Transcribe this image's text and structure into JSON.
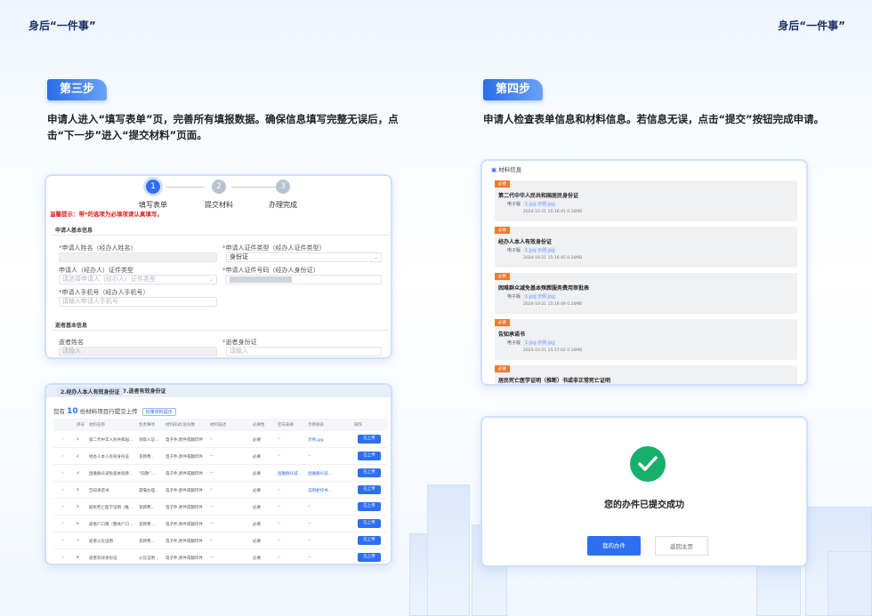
{
  "header": {
    "left_title": "身后“一件事”",
    "right_title": "身后“一件事”"
  },
  "step3": {
    "badge": "第三步",
    "desc_line1": "申请人进入“填写表单”页，完善所有填报数据。确保信息填写完整无误后，点",
    "desc_line2": "击“下一步”进入“提交材料”页面。"
  },
  "step4": {
    "badge": "第四步",
    "desc": "申请人检查表单信息和材料信息。若信息无误，点击“提交”按钮完成申请。"
  },
  "form_panel": {
    "steps": [
      {
        "num": "1",
        "label": "填写表单"
      },
      {
        "num": "2",
        "label": "提交材料"
      },
      {
        "num": "3",
        "label": "办理完成"
      }
    ],
    "warning": "温馨提示：带*的选项为必填项请认真填写。",
    "section1": "申请人基本信息",
    "f_name_label": "申请人姓名（经办人姓名）",
    "f_idtype_label": "申请人证件类型（经办人证件类型）",
    "f_idtype_value": "身份证",
    "f_idtype2_label": "申请人（经办人）证件类型",
    "f_idtype2_placeholder": "请选择申请人（经办人）证件类型",
    "f_idno_label": "申请人证件号码（经办人身份证）",
    "f_phone_label": "申请人手机号（经办人手机号）",
    "f_phone_placeholder": "请输入申请人手机号",
    "section2": "逝者基本信息",
    "f_dname_label": "逝者姓名",
    "f_dname_placeholder": "请输入",
    "f_did_label": "逝者身份证",
    "f_did_placeholder": "请输入",
    "required_mark": "*"
  },
  "table_panel": {
    "tab1": "2.经办人本人有效身份证",
    "tab2": "7.逝者有效身份证",
    "count_prefix": "您有",
    "count": "10",
    "count_suffix": "份材料项目行提交上传",
    "count_btn": "批量材料提示",
    "headers": [
      "序号",
      "材料名称",
      "负责事项",
      "材料形式/总份数",
      "材料描述",
      "必要性",
      "空白表格",
      "示例样表",
      "操作"
    ],
    "rows": [
      {
        "no": "1",
        "name": "第二代中华人民共和国…",
        "item": "领取人证…",
        "form": "电子件,原件或翻印件",
        "desc": "--",
        "need": "必要",
        "blank": "--",
        "sample": "示例.jpg",
        "op": "已上传"
      },
      {
        "no": "2",
        "name": "经办人本人有效身份证",
        "item": "丧葬费…",
        "form": "电子件,原件或翻印件",
        "desc": "--",
        "need": "必要",
        "blank": "--",
        "sample": "--",
        "op": "已上传"
      },
      {
        "no": "3",
        "name": "困难群众减免基本殡葬…",
        "item": "“四救”…",
        "form": "电子件,原件或翻印件",
        "desc": "--",
        "need": "必要",
        "blank": "困难群众减…",
        "sample": "困难群众减…",
        "op": "已上传"
      },
      {
        "no": "4",
        "name": "告知承诺书",
        "item": "遗嘱办理…",
        "form": "电子件,原件或翻印件",
        "desc": "--",
        "need": "必要",
        "blank": "--",
        "sample": "证明委托书…",
        "op": "已上传"
      },
      {
        "no": "5",
        "name": "居民死亡医学证明（推…",
        "item": "丧葬费…",
        "form": "电子件,原件或翻印件",
        "desc": "--",
        "need": "必要",
        "blank": "--",
        "sample": "--",
        "op": "已上传"
      },
      {
        "no": "6",
        "name": "逝者户口簿（整体户口…",
        "item": "丧葬费…",
        "form": "电子件,原件或翻印件",
        "desc": "--",
        "need": "必要",
        "blank": "--",
        "sample": "--",
        "op": "已上传"
      },
      {
        "no": "7",
        "name": "逝者火化证明",
        "item": "丧葬费…",
        "form": "电子件,原件或翻印件",
        "desc": "--",
        "need": "必要",
        "blank": "--",
        "sample": "--",
        "op": "已上传"
      },
      {
        "no": "8",
        "name": "逝者有效身份证",
        "item": "火化证明…",
        "form": "电子件,原件或翻印件",
        "desc": "--",
        "need": "必要",
        "blank": "--",
        "sample": "--",
        "op": "已上传"
      }
    ]
  },
  "materials_panel": {
    "title": "材料信息",
    "items": [
      {
        "tag": "必要",
        "name": "第二代中华人民共和国居民身份证",
        "type": "电子版",
        "file": "1.jpg  示例.jpg",
        "meta": "2024-10-21 15:16:41    0.16MB"
      },
      {
        "tag": "必要",
        "name": "经办人本人有效身份证",
        "type": "电子版",
        "file": "1.jpg  示例.jpg",
        "meta": "2024-10-21 15:16:45    0.16MB"
      },
      {
        "tag": "必要",
        "name": "困难群众减免基本殡葬服务费用审批表",
        "type": "电子版",
        "file": "1.jpg  示例.jpg",
        "meta": "2024-10-21 15:16:49    0.16MB"
      },
      {
        "tag": "必要",
        "name": "告知承诺书",
        "type": "电子版",
        "file": "1.jpg  示例.jpg",
        "meta": "2024-10-21 15:17:02    0.16MB"
      },
      {
        "tag": "必要",
        "name": "居民死亡医学证明（推断）书或非正常死亡证明",
        "type": "",
        "file": "",
        "meta": ""
      }
    ]
  },
  "success_panel": {
    "message": "您的办件已提交成功",
    "btn_primary": "我的办件",
    "btn_secondary": "返回主页"
  },
  "colors": {
    "accent": "#2d6ff0",
    "success": "#16b06a",
    "warning": "#d22222",
    "tag": "#f07a2b",
    "title": "#1d2f67"
  }
}
